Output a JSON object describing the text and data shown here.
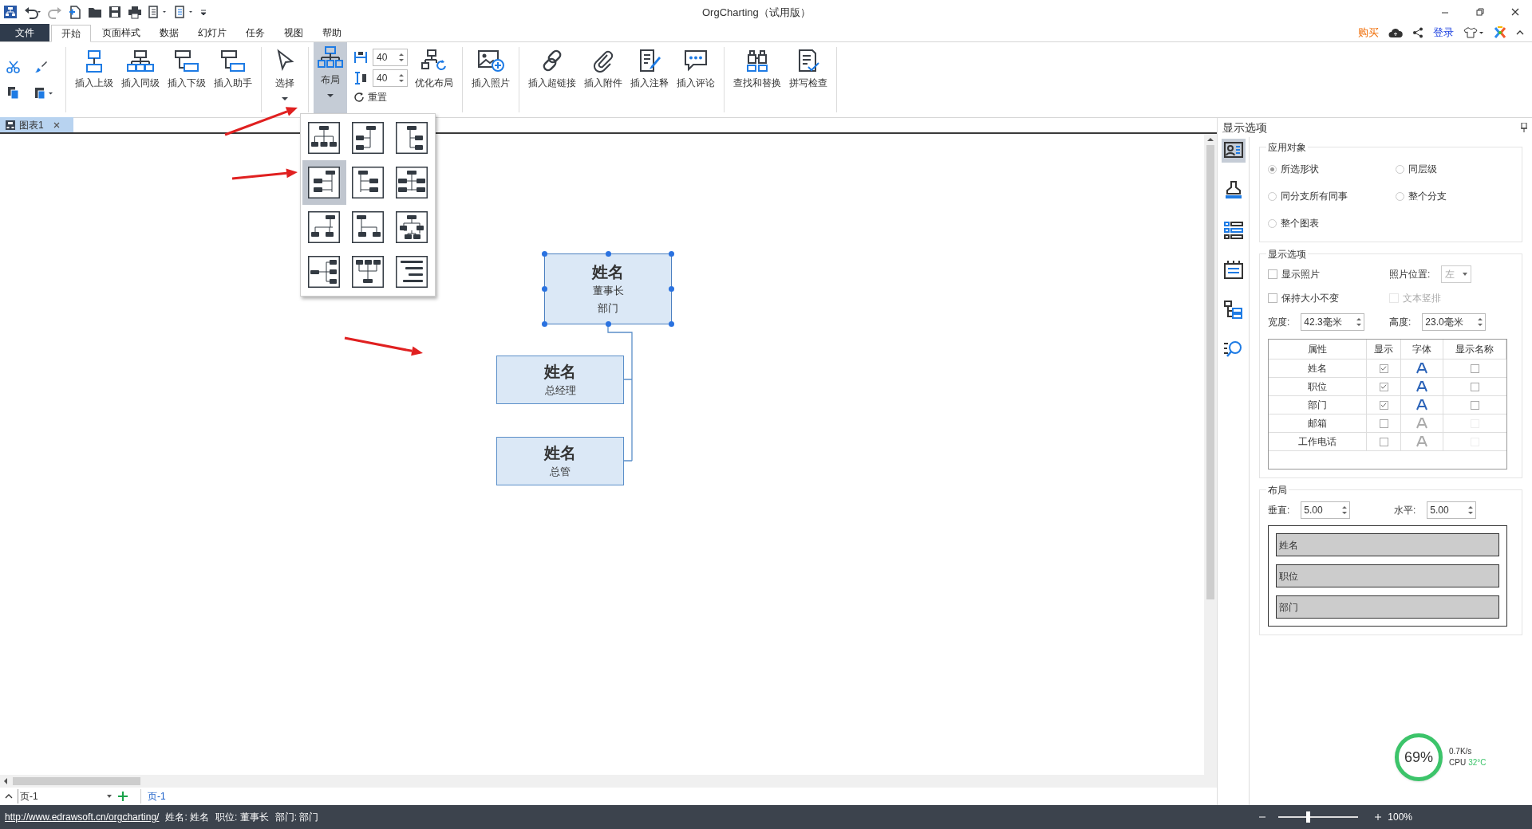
{
  "window": {
    "title": "OrgCharting（试用版）"
  },
  "menu_tabs": [
    {
      "label": "文件",
      "kind": "file",
      "selected": false
    },
    {
      "label": "开始",
      "kind": "tab",
      "selected": true
    },
    {
      "label": "页面样式",
      "kind": "tab",
      "selected": false
    },
    {
      "label": "数据",
      "kind": "tab",
      "selected": false
    },
    {
      "label": "幻灯片",
      "kind": "tab",
      "selected": false
    },
    {
      "label": "任务",
      "kind": "tab",
      "selected": false
    },
    {
      "label": "视图",
      "kind": "tab",
      "selected": false
    },
    {
      "label": "帮助",
      "kind": "tab",
      "selected": false
    }
  ],
  "account": {
    "buy": "购买",
    "login": "登录"
  },
  "ribbon": {
    "insert_buttons": [
      "插入上级",
      "插入同级",
      "插入下级",
      "插入助手"
    ],
    "select_button": "选择",
    "layout_button": {
      "label": "布局",
      "expanded": true
    },
    "spacing": [
      "40",
      "40"
    ],
    "reset_button": "重置",
    "optimize_button": "优化布局",
    "photo_button": "插入照片",
    "attach_buttons": [
      "插入超链接",
      "插入附件",
      "插入注释",
      "插入评论"
    ],
    "tool_buttons": [
      "查找和替换",
      "拼写检查"
    ]
  },
  "layout_options": [
    {
      "selected": false
    },
    {
      "selected": false
    },
    {
      "selected": false
    },
    {
      "selected": true
    },
    {
      "selected": false
    },
    {
      "selected": false
    },
    {
      "selected": false
    },
    {
      "selected": false
    },
    {
      "selected": false
    },
    {
      "selected": false
    },
    {
      "selected": false
    },
    {
      "selected": false
    }
  ],
  "document_tabs": [
    {
      "label": "图表1",
      "selected": true
    }
  ],
  "chart": {
    "nodes": [
      {
        "name": "姓名",
        "lines": [
          "董事长",
          "部门"
        ],
        "selected": true
      },
      {
        "name": "姓名",
        "lines": [
          "总经理"
        ],
        "selected": false
      },
      {
        "name": "姓名",
        "lines": [
          "总管"
        ],
        "selected": false
      }
    ]
  },
  "panel": {
    "title": "显示选项",
    "side_tabs": [
      {
        "selected": true
      },
      {
        "selected": false
      },
      {
        "selected": false
      },
      {
        "selected": false
      },
      {
        "selected": false
      },
      {
        "selected": false
      }
    ],
    "apply_to": {
      "title": "应用对象",
      "options": [
        {
          "label": "所选形状",
          "selected": true
        },
        {
          "label": "同层级",
          "selected": false
        },
        {
          "label": "同分支所有同事",
          "selected": false
        },
        {
          "label": "整个分支",
          "selected": false
        },
        {
          "label": "整个图表",
          "selected": false
        }
      ]
    },
    "display": {
      "title": "显示选项",
      "show_photo": {
        "label": "显示照片",
        "checked": false
      },
      "photo_position": {
        "label": "照片位置:",
        "value": "左",
        "disabled": true
      },
      "keep_size": {
        "label": "保持大小不变",
        "checked": false
      },
      "vertical_text": {
        "label": "文本竖排",
        "checked": false,
        "disabled": true
      },
      "width": {
        "label": "宽度:",
        "value": "42.3毫米"
      },
      "height": {
        "label": "高度:",
        "value": "23.0毫米"
      },
      "columns": [
        "属性",
        "显示",
        "字体",
        "显示名称"
      ],
      "rows": [
        {
          "label": "姓名",
          "show": true,
          "show_name": false
        },
        {
          "label": "职位",
          "show": true,
          "show_name": false
        },
        {
          "label": "部门",
          "show": true,
          "show_name": false
        },
        {
          "label": "邮箱",
          "show": false,
          "show_name": false
        },
        {
          "label": "工作电话",
          "show": false,
          "show_name": false
        }
      ]
    },
    "layout": {
      "title": "布局",
      "vertical": {
        "label": "垂直:",
        "value": "5.00"
      },
      "horizontal": {
        "label": "水平:",
        "value": "5.00"
      },
      "fields": [
        "姓名",
        "职位",
        "部门"
      ]
    }
  },
  "page_bar": {
    "page_select": "页-1",
    "pages": [
      {
        "label": "页-1",
        "selected": true
      }
    ]
  },
  "status_bar": {
    "link": "http://www.edrawsoft.cn/orgcharting/",
    "fields": [
      "姓名: 姓名",
      "职位: 董事长",
      "部门: 部门"
    ],
    "zoom": "100%",
    "zoom_slider": {
      "level": 0.33
    }
  },
  "monitor_widget": {
    "percent": "69%",
    "speed": "0.7K/s",
    "cpu": "CPU",
    "temperature": "32°C"
  }
}
